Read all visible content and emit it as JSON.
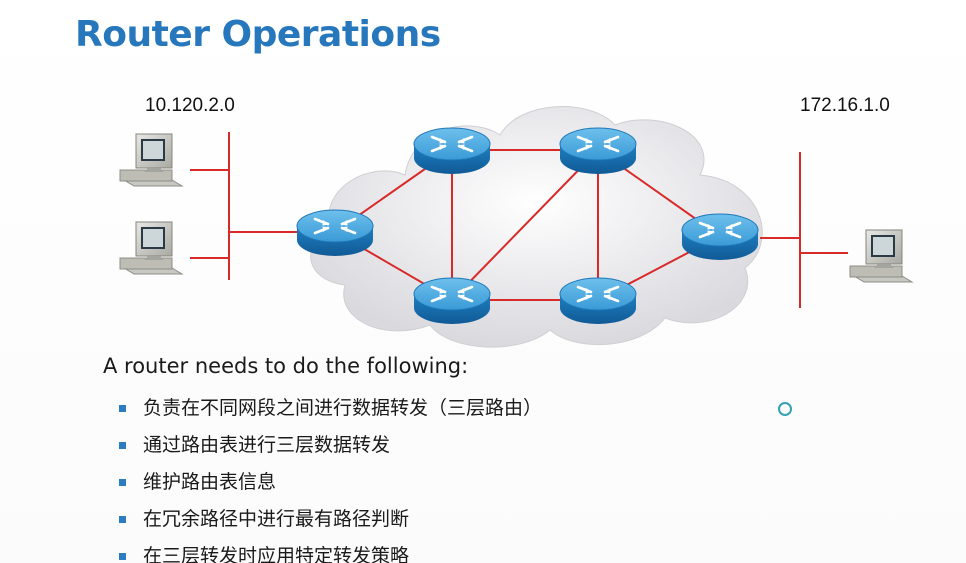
{
  "slide": {
    "title": "Router Operations",
    "network_left_label": "10.120.2.0",
    "network_right_label": "172.16.1.0",
    "lead_text": "A router needs to do the following:",
    "bullets": [
      "负责在不同网段之间进行数据转发（三层路由）",
      "通过路由表进行三层数据转发",
      "维护路由表信息",
      "在冗余路径中进行最有路径判断",
      "在三层转发时应用特定转发策略"
    ]
  },
  "diagram": {
    "link_color": "#d92a2a",
    "router_color": "#2a8fcf",
    "cloud_color": "#e6e6ea",
    "icons": [
      "workstation-icon",
      "router-icon",
      "cloud-icon"
    ]
  },
  "colors": {
    "title": "#2777bd",
    "bullet": "#2c7cc2"
  }
}
